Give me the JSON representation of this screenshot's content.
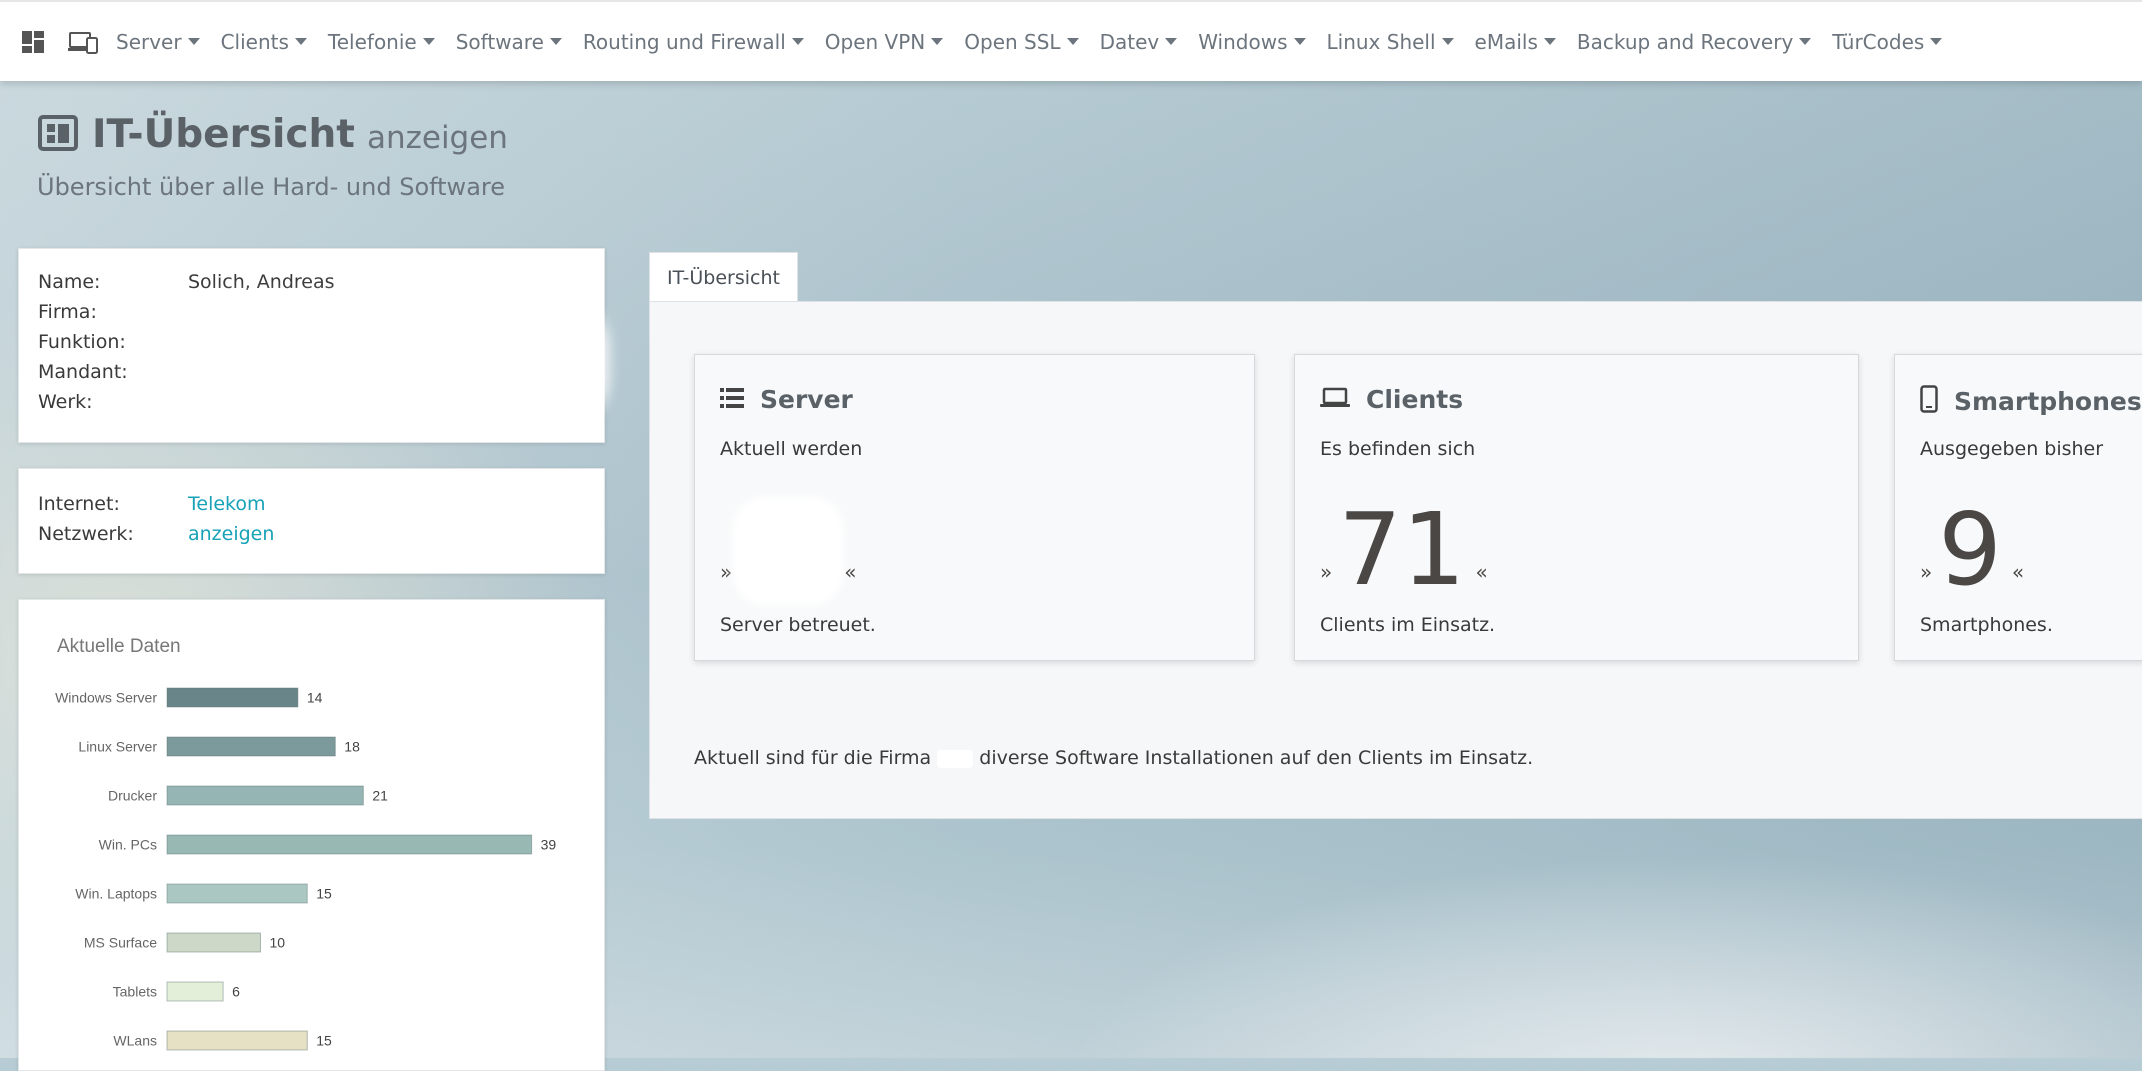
{
  "nav": {
    "items": [
      {
        "label": "Server"
      },
      {
        "label": "Clients"
      },
      {
        "label": "Telefonie"
      },
      {
        "label": "Software"
      },
      {
        "label": "Routing und Firewall"
      },
      {
        "label": "Open VPN"
      },
      {
        "label": "Open SSL"
      },
      {
        "label": "Datev"
      },
      {
        "label": "Windows"
      },
      {
        "label": "Linux Shell"
      },
      {
        "label": "eMails"
      },
      {
        "label": "Backup and Recovery"
      },
      {
        "label": "TürCodes"
      }
    ],
    "icons": {
      "dashboard": "dashboard-icon",
      "devices": "devices-icon"
    }
  },
  "header": {
    "title": "IT-Übersicht",
    "title_suffix": "anzeigen",
    "subtitle": "Übersicht über alle Hard- und Software",
    "icon": "overview-icon"
  },
  "user_info": {
    "rows": [
      {
        "label": "Name:",
        "value": "Solich, Andreas"
      },
      {
        "label": "Firma:",
        "value": ""
      },
      {
        "label": "Funktion:",
        "value": ""
      },
      {
        "label": "Mandant:",
        "value": ""
      },
      {
        "label": "Werk:",
        "value": ""
      }
    ]
  },
  "network_info": {
    "internet_label": "Internet:",
    "internet_value": "Telekom",
    "network_label": "Netzwerk:",
    "network_link": "anzeigen"
  },
  "chart_data": {
    "type": "bar",
    "orientation": "horizontal",
    "title": "Aktuelle Daten",
    "categories": [
      "Windows Server",
      "Linux Server",
      "Drucker",
      "Win. PCs",
      "Win. Laptops",
      "MS Surface",
      "Tablets",
      "WLans"
    ],
    "values": [
      14,
      18,
      21,
      39,
      15,
      10,
      6,
      15
    ],
    "colors": [
      "#6a8589",
      "#7c999b",
      "#94b5b3",
      "#98b8b4",
      "#aac8c1",
      "#cdd8c8",
      "#e3efd8",
      "#e6e1c4"
    ],
    "xlim": [
      0,
      40
    ],
    "grid": false,
    "legend": "none"
  },
  "tabs": [
    {
      "label": "IT-Übersicht"
    }
  ],
  "stats": {
    "server": {
      "title": "Server",
      "line1": "Aktuell werden",
      "value": "",
      "line2": "Server betreuet.",
      "icon": "server-icon"
    },
    "clients": {
      "title": "Clients",
      "line1": "Es befinden sich",
      "value": "71",
      "line2": "Clients im Einsatz.",
      "icon": "laptop-icon"
    },
    "smartphones": {
      "title": "Smartphones",
      "line1": "Ausgegeben bisher",
      "value": "9",
      "line2": "Smartphones.",
      "icon": "smartphone-icon"
    },
    "quote_open": "»",
    "quote_close": "«"
  },
  "software_note": {
    "before": "Aktuell sind für die Firma",
    "after": "diverse Software Installationen auf den Clients im Einsatz."
  }
}
